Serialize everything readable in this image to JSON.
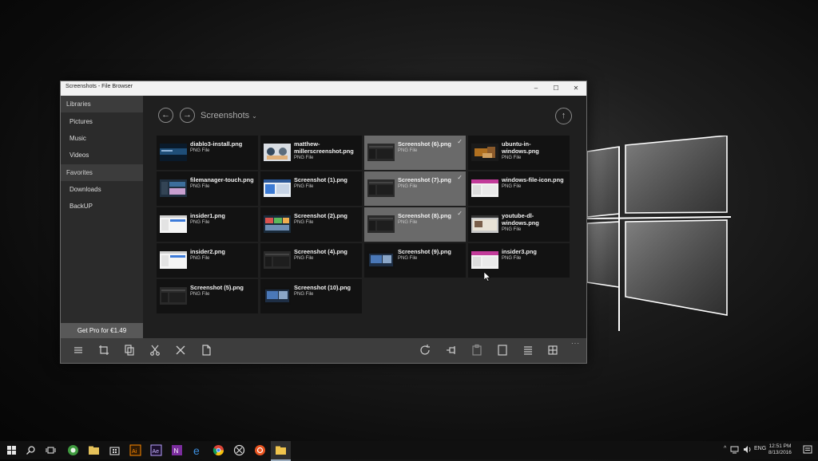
{
  "window": {
    "title": "Screenshots - File Browser",
    "controls": [
      "–",
      "☐",
      "✕"
    ]
  },
  "sidebar": {
    "items": [
      {
        "label": "Libraries",
        "kind": "section"
      },
      {
        "label": "Pictures",
        "kind": "entry"
      },
      {
        "label": "Music",
        "kind": "entry"
      },
      {
        "label": "Videos",
        "kind": "entry"
      },
      {
        "label": "Favorites",
        "kind": "section"
      },
      {
        "label": "Downloads",
        "kind": "entry"
      },
      {
        "label": "BackUP",
        "kind": "entry"
      }
    ],
    "get_pro": "Get Pro for €1.49"
  },
  "main": {
    "breadcrumb": "Screenshots",
    "back_icon": "back-arrow-icon",
    "forward_icon": "forward-arrow-icon",
    "up_icon": "up-arrow-icon"
  },
  "files": [
    {
      "name": "diablo3-install.png",
      "type": "PNG File",
      "selected": false,
      "thumb": "dark-blue"
    },
    {
      "name": "matthew-millerscreenshot.png",
      "type": "PNG File",
      "selected": false,
      "thumb": "avatars"
    },
    {
      "name": "Screenshot (6).png",
      "type": "PNG File",
      "selected": true,
      "thumb": "dark"
    },
    {
      "name": "ubuntu-in-windows.png",
      "type": "PNG File",
      "selected": false,
      "thumb": "ubuntu"
    },
    {
      "name": "filemanager-touch.png",
      "type": "PNG File",
      "selected": false,
      "thumb": "ui-dark"
    },
    {
      "name": "Screenshot (1).png",
      "type": "PNG File",
      "selected": false,
      "thumb": "ui-light"
    },
    {
      "name": "Screenshot (7).png",
      "type": "PNG File",
      "selected": true,
      "thumb": "dark"
    },
    {
      "name": "windows-file-icon.png",
      "type": "PNG File",
      "selected": false,
      "thumb": "ui-pink"
    },
    {
      "name": "insider1.png",
      "type": "PNG File",
      "selected": false,
      "thumb": "white"
    },
    {
      "name": "Screenshot (2).png",
      "type": "PNG File",
      "selected": false,
      "thumb": "ui-color"
    },
    {
      "name": "Screenshot (8).png",
      "type": "PNG File",
      "selected": true,
      "thumb": "dark"
    },
    {
      "name": "youtube-dl-windows.png",
      "type": "PNG File",
      "selected": false,
      "thumb": "youtube"
    },
    {
      "name": "insider2.png",
      "type": "PNG File",
      "selected": false,
      "thumb": "white"
    },
    {
      "name": "Screenshot (4).png",
      "type": "PNG File",
      "selected": false,
      "thumb": "dark"
    },
    {
      "name": "Screenshot (9).png",
      "type": "PNG File",
      "selected": false,
      "thumb": "ui-blue"
    },
    {
      "name": "insider3.png",
      "type": "PNG File",
      "selected": false,
      "thumb": "ui-pink"
    },
    {
      "name": "Screenshot (5).png",
      "type": "PNG File",
      "selected": false,
      "thumb": "dark"
    },
    {
      "name": "Screenshot (10).png",
      "type": "PNG File",
      "selected": false,
      "thumb": "ui-blue"
    }
  ],
  "toolbar": {
    "left_icons": [
      "list-icon",
      "crop-icon",
      "copy-icon",
      "cut-icon",
      "delete-icon",
      "new-file-icon"
    ],
    "right_icons": [
      "refresh-icon",
      "pin-icon",
      "paste-icon",
      "select-icon",
      "details-view-icon",
      "grid-view-icon"
    ],
    "more": "···"
  },
  "taskbar": {
    "apps": [
      "start-icon",
      "search-icon",
      "task-view-icon",
      "android-icon",
      "file-explorer-icon",
      "store-icon",
      "illustrator-icon",
      "after-effects-icon",
      "onenote-icon",
      "edge-icon",
      "chrome-icon",
      "xbox-icon",
      "ubuntu-icon",
      "file-browser-icon"
    ],
    "tray_chevron": "^",
    "language": "ENG",
    "time": "12:51 PM",
    "date": "8/13/2016"
  }
}
